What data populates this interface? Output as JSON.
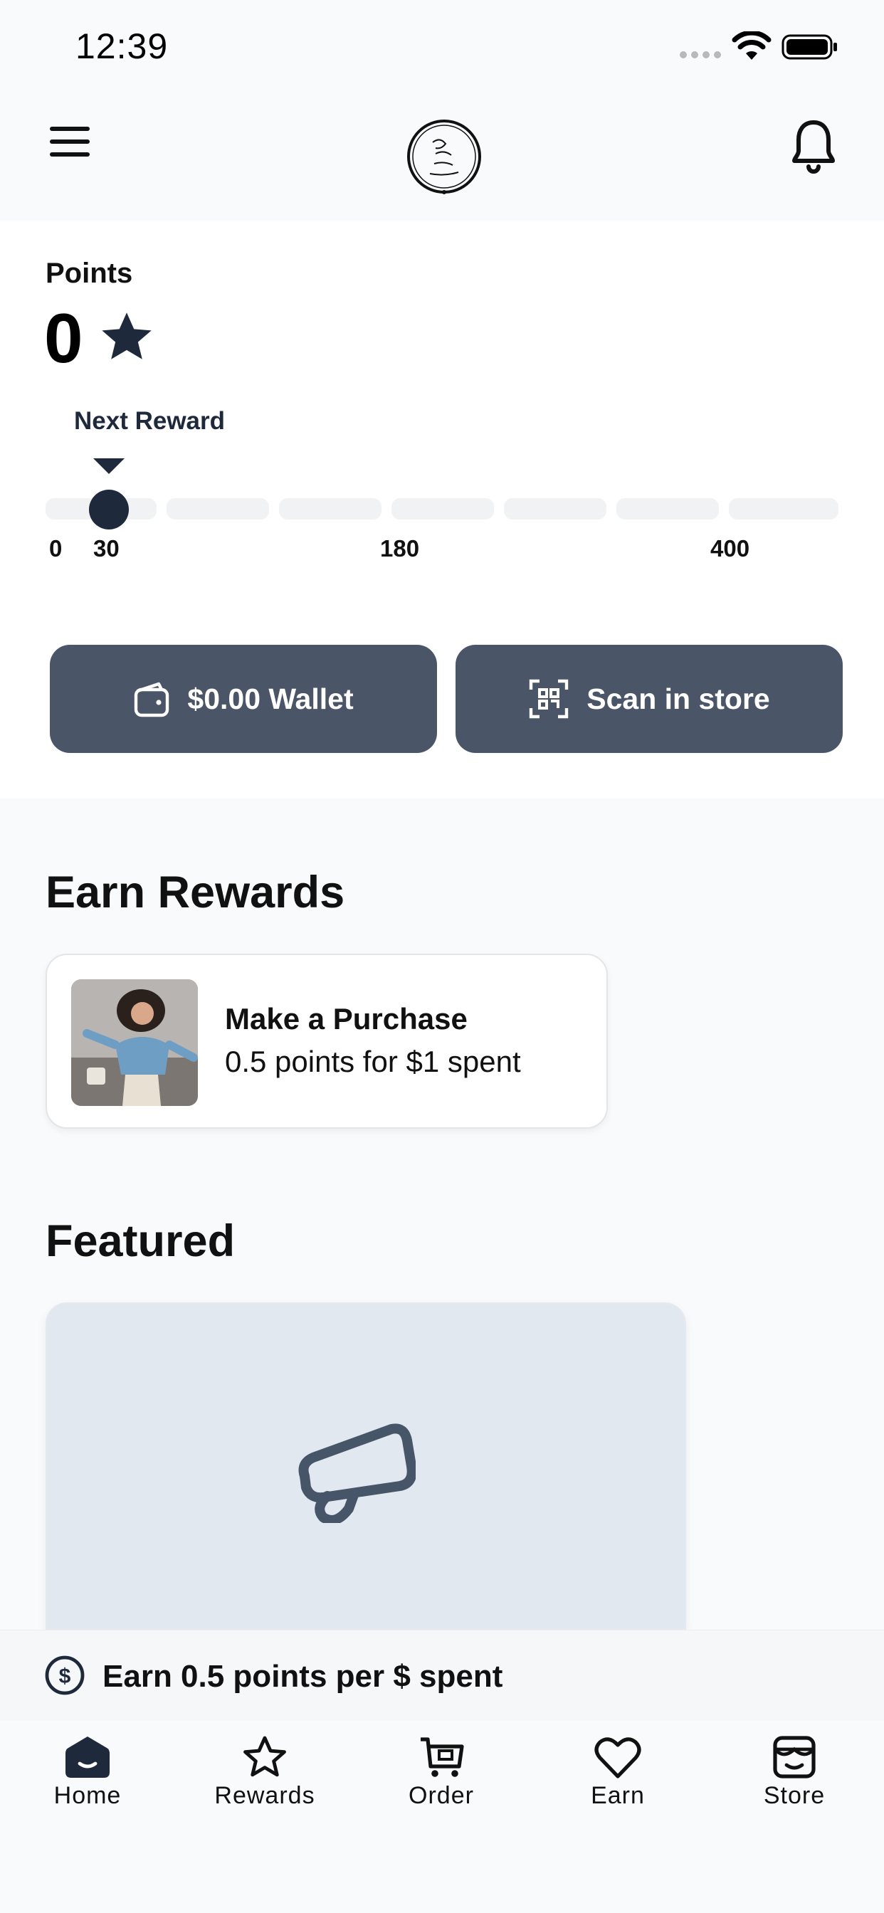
{
  "status_bar": {
    "time": "12:39"
  },
  "header": {
    "menu_icon": "hamburger-menu-icon",
    "logo_icon": "brand-logo-seal",
    "notifications_icon": "bell-icon"
  },
  "points": {
    "label": "Points",
    "value": "0",
    "star_icon": "star-icon",
    "next_reward_label": "Next Reward",
    "progress_fraction": 0.0,
    "ticks": [
      "0",
      "30",
      "180",
      "400"
    ]
  },
  "actions": {
    "wallet_label": "$0.00 Wallet",
    "scan_label": "Scan in store"
  },
  "earn_rewards": {
    "title": "Earn Rewards",
    "items": [
      {
        "title": "Make a Purchase",
        "description": "0.5 points for $1 spent"
      }
    ]
  },
  "featured": {
    "title": "Featured",
    "placeholder_icon": "megaphone-icon"
  },
  "banner": {
    "text": "Earn 0.5 points per $ spent",
    "icon": "dollar-circle-icon"
  },
  "tabs": [
    {
      "label": "Home",
      "icon": "home-icon",
      "active": true
    },
    {
      "label": "Rewards",
      "icon": "star-icon"
    },
    {
      "label": "Order",
      "icon": "cart-icon"
    },
    {
      "label": "Earn",
      "icon": "heart-icon"
    },
    {
      "label": "Store",
      "icon": "store-icon"
    }
  ],
  "colors": {
    "primary_button": "#4a5568",
    "accent_dark": "#1e293b",
    "featured_bg": "#e2e8f0"
  }
}
